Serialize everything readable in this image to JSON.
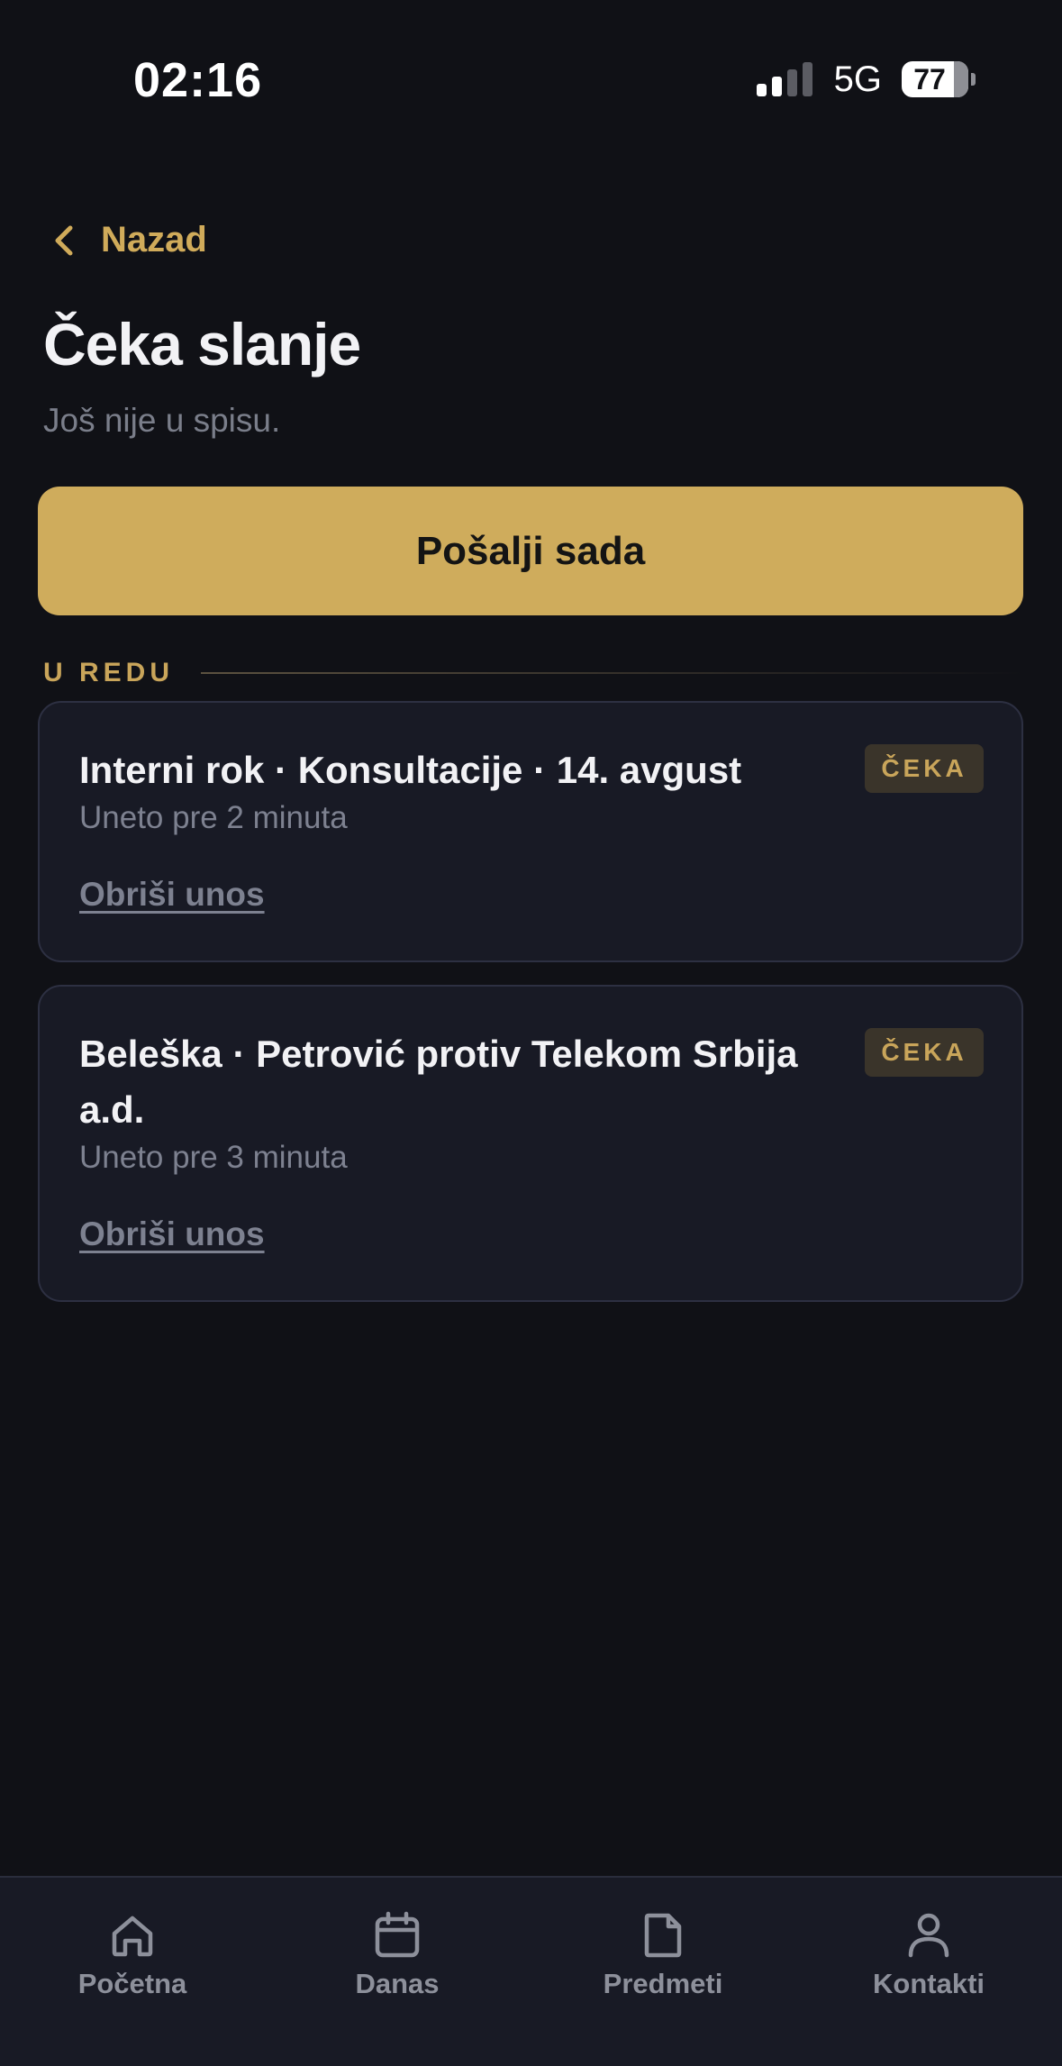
{
  "status_bar": {
    "time": "02:16",
    "network": "5G",
    "battery": "77"
  },
  "header": {
    "back_label": "Nazad",
    "title": "Čeka slanje",
    "subtitle": "Još nije u spisu."
  },
  "send_button": {
    "label": "Pošalji sada"
  },
  "section": {
    "label": "U REDU"
  },
  "queue": [
    {
      "title": "Interni rok · Konsultacije · 14. avgust",
      "time": "Uneto pre 2 minuta",
      "badge": "ČEKA",
      "delete_label": "Obriši unos"
    },
    {
      "title": "Beleška · Petrović protiv Telekom Srbija a.d.",
      "time": "Uneto pre 3 minuta",
      "badge": "ČEKA",
      "delete_label": "Obriši unos"
    }
  ],
  "tabbar": {
    "items": [
      {
        "label": "Početna",
        "icon": "home-icon"
      },
      {
        "label": "Danas",
        "icon": "calendar-icon"
      },
      {
        "label": "Predmeti",
        "icon": "document-icon"
      },
      {
        "label": "Kontakti",
        "icon": "person-icon"
      }
    ]
  },
  "colors": {
    "background": "#101116",
    "accent": "#CFAC5C",
    "card": "#181A25",
    "muted": "#7D8190"
  }
}
